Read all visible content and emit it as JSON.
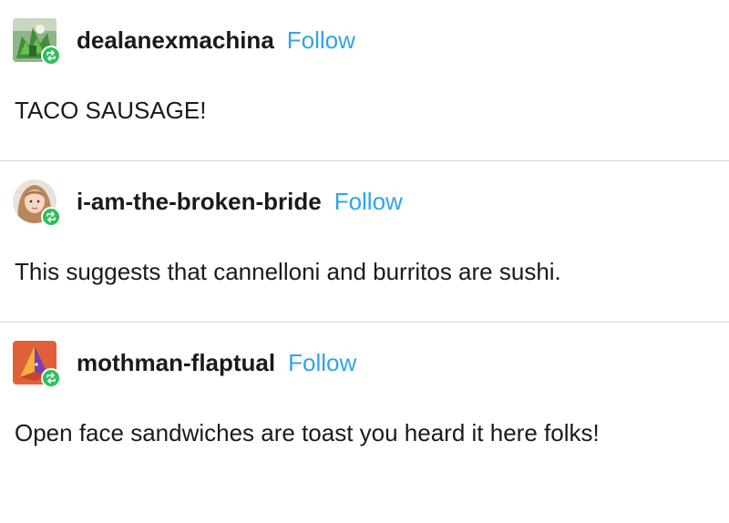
{
  "posts": [
    {
      "username": "dealanexmachina",
      "follow_label": "Follow",
      "text": "TACO SAUSAGE!",
      "avatar_icon": "green-leaf-avatar-icon"
    },
    {
      "username": "i-am-the-broken-bride",
      "follow_label": "Follow",
      "text": "This suggests that cannelloni and burritos are sushi.",
      "avatar_icon": "portrait-avatar-icon"
    },
    {
      "username": "mothman-flaptual",
      "follow_label": "Follow",
      "text": "Open face sandwiches are toast you heard it here folks!",
      "avatar_icon": "orange-pyramid-avatar-icon"
    }
  ],
  "colors": {
    "follow": "#2fa4e7",
    "reblog_badge": "#2ebf5e",
    "divider": "#d9d9d9"
  }
}
